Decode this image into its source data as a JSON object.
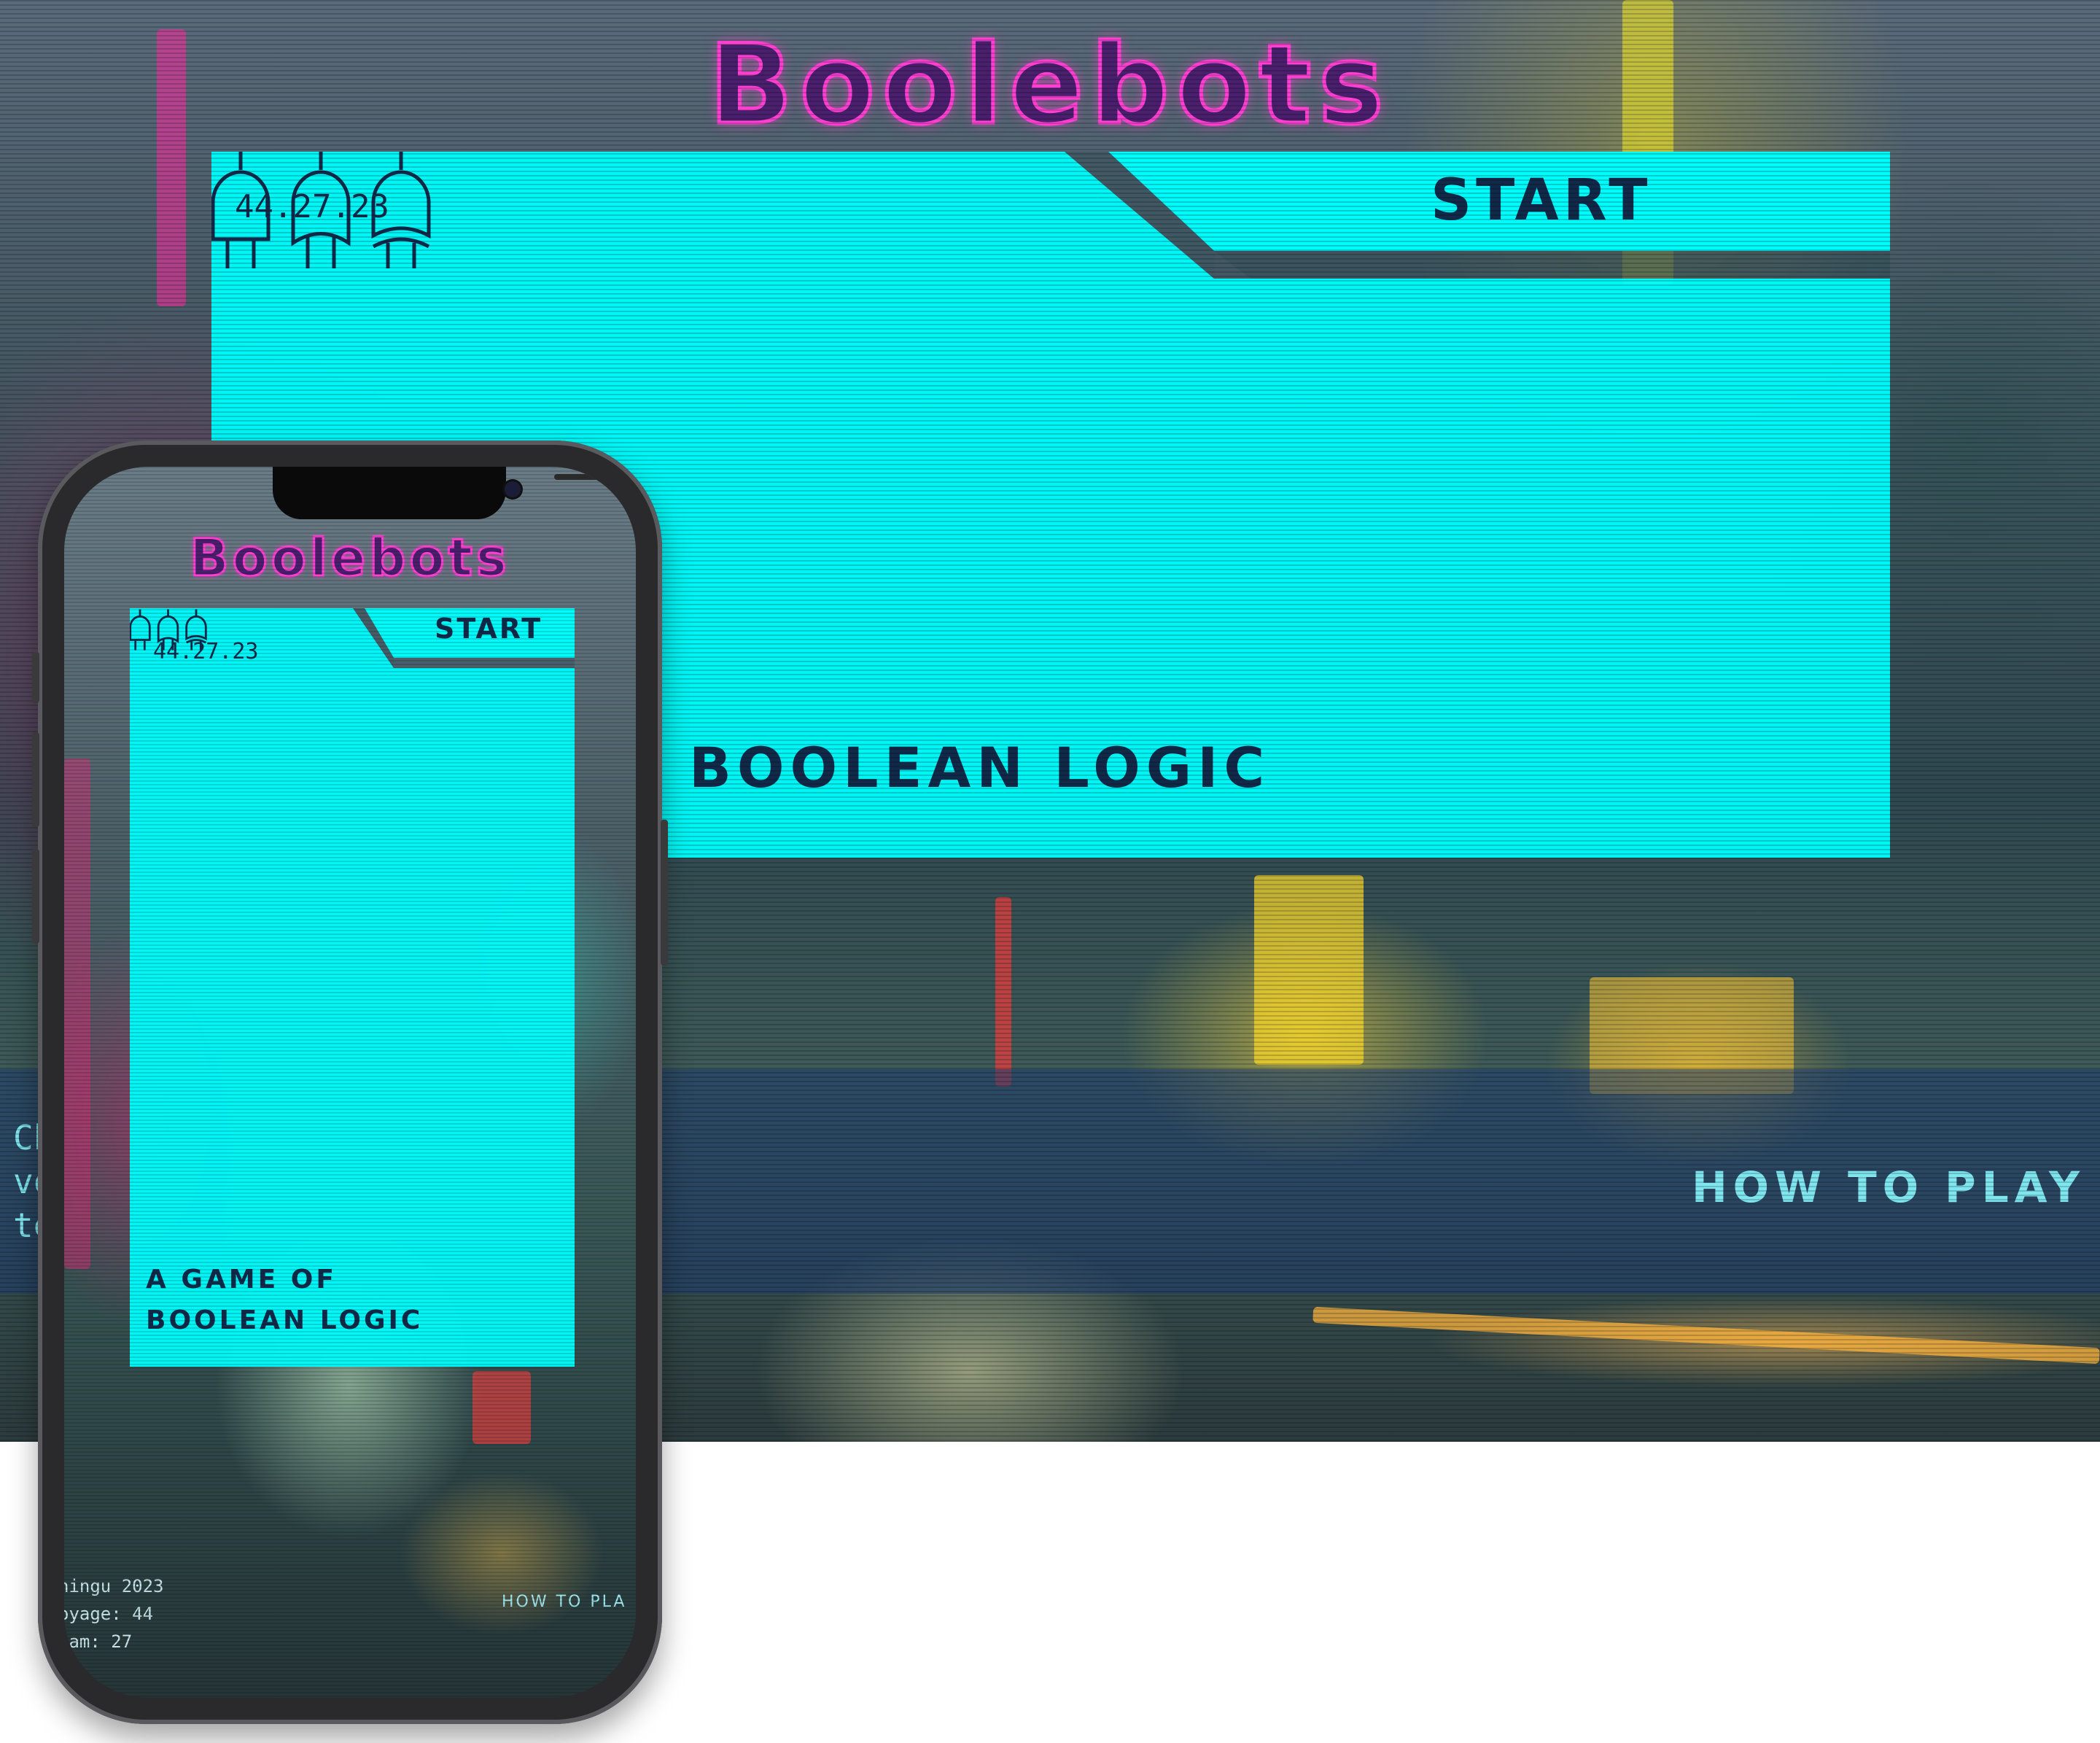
{
  "app": {
    "title": "Boolebots",
    "start_label": "START",
    "subtitle_desktop": "BOOLEAN LOGIC",
    "subtitle_mobile_line1": "A GAME OF",
    "subtitle_mobile_line2": "BOOLEAN LOGIC",
    "date": "44.27.23",
    "how_to_play": "HOW TO PLAY",
    "desktop_info_lines": [
      "Ch",
      "vo",
      "te"
    ],
    "mobile_info_lines": [
      "hingu 2023",
      "oyage: 44",
      "eam: 27"
    ],
    "mobile_how_to_play": "HOW TO PLA"
  },
  "icons": [
    "and-gate-icon",
    "or-gate-icon",
    "xor-gate-icon"
  ],
  "colors": {
    "panel": "#00fbfb",
    "title_stroke": "#ff3fd2",
    "title_fill": "#4a1f6e",
    "text_dark": "#122a4a",
    "accent_text": "#7fe6ef"
  }
}
